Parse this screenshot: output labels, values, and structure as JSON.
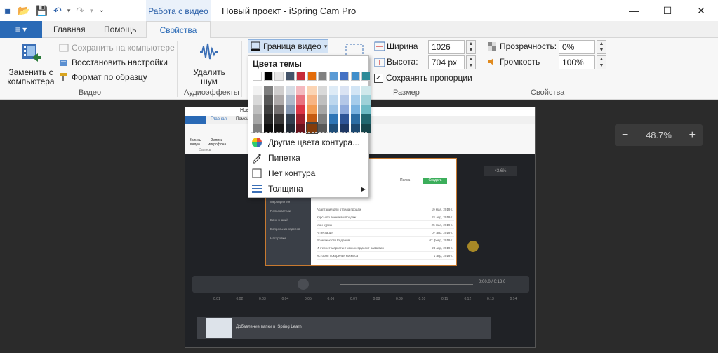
{
  "titlebar": {
    "context_tab": "Работа с видео",
    "window_title": "Новый проект - iSpring Cam Pro",
    "minimize": "—",
    "maximize": "☐",
    "close": "✕"
  },
  "qat": {
    "app": "▣",
    "open": "📂",
    "save": "💾",
    "undo": "↶",
    "undo_dd": "▾",
    "redo": "↷",
    "redo_dd": "▾",
    "custom": "⌄"
  },
  "tabs": {
    "file": "≡ ▾",
    "home": "Главная",
    "help": "Помощь",
    "properties": "Свойства"
  },
  "ribbon": {
    "video": {
      "replace": "Заменить с компьютера",
      "save_to_pc": "Сохранить на компьютере",
      "restore": "Восстановить настройки",
      "format_painter": "Формат по образцу",
      "label": "Видео"
    },
    "audio": {
      "remove_noise": "Удалить шум",
      "label": "Аудиоэффекты"
    },
    "border": {
      "label": "Граница видео",
      "arrow": "▾"
    },
    "size": {
      "width_label": "Ширина",
      "width_value": "1026 px",
      "height_label": "Высота:",
      "height_value": "704 px",
      "keep_ratio": "Сохранять пропорции",
      "keep_ratio_check": "✓",
      "label": "Размер"
    },
    "props": {
      "opacity_label": "Прозрачность:",
      "opacity_value": "0%",
      "volume_label": "Громкость",
      "volume_value": "100%",
      "label": "Свойства"
    }
  },
  "zoom": {
    "minus": "−",
    "value": "48.7%",
    "plus": "+"
  },
  "dropdown": {
    "theme_colors": "Цвета темы",
    "top_row": [
      "#ffffff",
      "#000000",
      "#e7e6e6",
      "#44546a",
      "#c62b3a",
      "#e36c0a",
      "#808080",
      "#5b9bd5",
      "#4472c4",
      "#3f8ecb",
      "#2e8b98"
    ],
    "shades": [
      [
        "#f2f2f2",
        "#7f7f7f",
        "#d0cece",
        "#d6dce4",
        "#f4b9bf",
        "#fbd4b4",
        "#d9d9d9",
        "#deebf6",
        "#dae3f3",
        "#d2e5f5",
        "#cfe8eb"
      ],
      [
        "#d9d9d9",
        "#595959",
        "#aeaaaa",
        "#adb9ca",
        "#e9727f",
        "#f7b484",
        "#bfbfbf",
        "#bdd7ee",
        "#b4c7e7",
        "#a5cceb",
        "#9ed1d8"
      ],
      [
        "#bfbfbf",
        "#3f3f3f",
        "#757171",
        "#8496b0",
        "#dc3545",
        "#f29b53",
        "#a6a6a6",
        "#9dc3e6",
        "#8faadc",
        "#79b2e0",
        "#6dbac4"
      ],
      [
        "#a6a6a6",
        "#262626",
        "#3a3838",
        "#323f4f",
        "#9c1e2b",
        "#c55a11",
        "#7f7f7f",
        "#2e75b6",
        "#2f5597",
        "#2b6ca3",
        "#21666f"
      ],
      [
        "#7f7f7f",
        "#0d0d0d",
        "#171616",
        "#222a35",
        "#68141d",
        "#833c0b",
        "#595959",
        "#1f4e79",
        "#1f3864",
        "#1c4870",
        "#16444a"
      ]
    ],
    "more_colors": "Другие цвета контура...",
    "eyedropper": "Пипетка",
    "no_outline": "Нет контура",
    "thickness": "Толщина",
    "submenu_arrow": "▶"
  },
  "preview": {
    "inner_home": "Главная",
    "inner_help": "Помощь",
    "inner_title": "Новы",
    "inner_zoom": "43.6%",
    "rec_video": "Запись видео",
    "rec_mic": "Запись микрофона",
    "rec_label": "Запись",
    "folder": "Папка",
    "create": "Создать",
    "table": [
      {
        "name": "Адаптация для отдела продаж",
        "date": "19 мая, 2019 г."
      },
      {
        "name": "Курсы по техникам продаж",
        "date": "21 апр, 2019 г."
      },
      {
        "name": "Мои курсы",
        "date": "25 мая, 2019 г."
      },
      {
        "name": "Аттестация",
        "date": "07 апр, 2019 г."
      },
      {
        "name": "Возможности Евдения",
        "date": "07 февр, 2019 г."
      },
      {
        "name": "Интернет-маркетинг как инструмент развития",
        "date": "28 апр, 2019 г."
      },
      {
        "name": "История покорения космоса",
        "date": "1 апр, 2019 г."
      }
    ],
    "sidebar": [
      "Мероприятия",
      "Пользователи",
      "Банк знаний",
      "Вопросы из отделов",
      "Настройки"
    ],
    "time": "0:00.0 / 0:13.0",
    "ticks": [
      "0:01",
      "0:02",
      "0:03",
      "0:04",
      "0:05",
      "0:06",
      "0:07",
      "0:08",
      "0:09",
      "0:10",
      "0:11",
      "0:12",
      "0:13",
      "0:14"
    ],
    "clip_title": "Добавление папки в iSpring Learn"
  }
}
